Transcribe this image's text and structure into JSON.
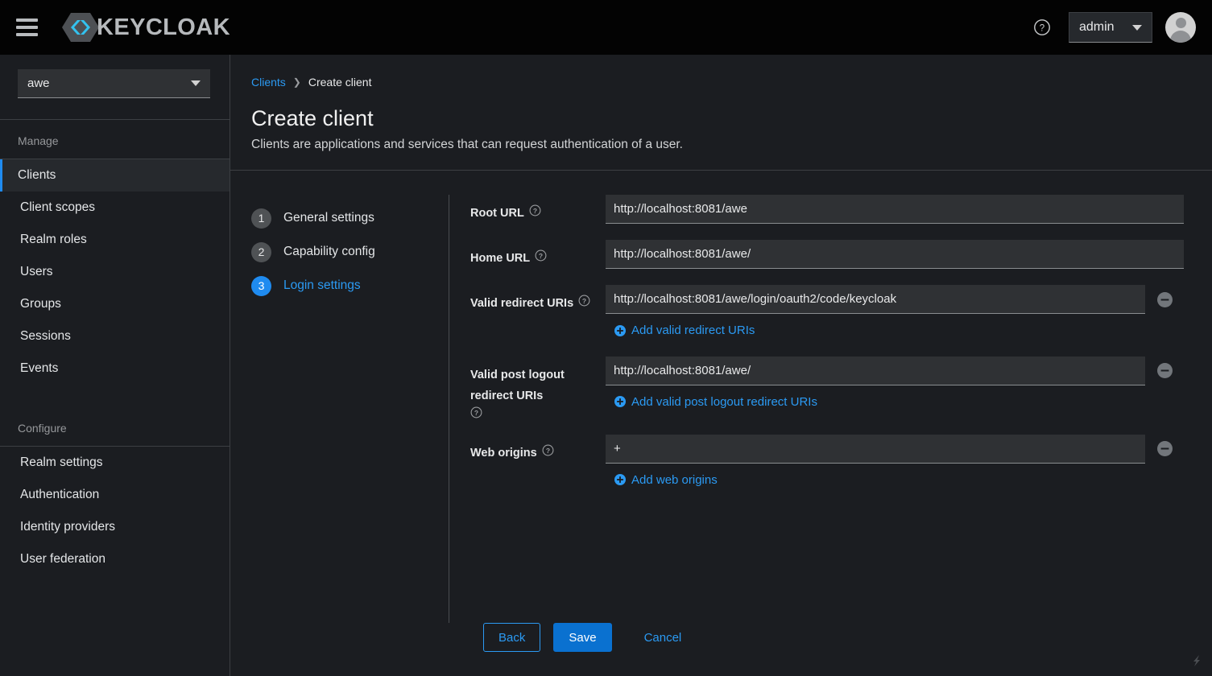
{
  "masthead": {
    "menu_toggle_label": "Global navigation",
    "brand_text": "KEYCLOAK",
    "help_label": "Help",
    "admin_menu_label": "admin",
    "avatar_label": "User avatar"
  },
  "sidebar": {
    "realm_selector": {
      "value": "awe"
    },
    "groups": [
      {
        "title": "Manage",
        "items": [
          {
            "label": "Clients",
            "active": true
          },
          {
            "label": "Client scopes",
            "active": false
          },
          {
            "label": "Realm roles",
            "active": false
          },
          {
            "label": "Users",
            "active": false
          },
          {
            "label": "Groups",
            "active": false
          },
          {
            "label": "Sessions",
            "active": false
          },
          {
            "label": "Events",
            "active": false
          }
        ]
      },
      {
        "title": "Configure",
        "items": [
          {
            "label": "Realm settings",
            "active": false
          },
          {
            "label": "Authentication",
            "active": false
          },
          {
            "label": "Identity providers",
            "active": false
          },
          {
            "label": "User federation",
            "active": false
          }
        ]
      }
    ]
  },
  "breadcrumb": {
    "parent": "Clients",
    "separator": "❯",
    "current": "Create client"
  },
  "page": {
    "title": "Create client",
    "subtitle": "Clients are applications and services that can request authentication of a user."
  },
  "wizard": {
    "steps": [
      {
        "num": "1",
        "label": "General settings",
        "active": false
      },
      {
        "num": "2",
        "label": "Capability config",
        "active": false
      },
      {
        "num": "3",
        "label": "Login settings",
        "active": true
      }
    ]
  },
  "form": {
    "fields": [
      {
        "label": "Root URL",
        "value": "http://localhost:8081/awe",
        "placeholder": "",
        "has_remove": false,
        "add_label": ""
      },
      {
        "label": "Home URL",
        "value": "http://localhost:8081/awe/",
        "placeholder": "",
        "has_remove": false,
        "add_label": ""
      },
      {
        "label": "Valid redirect URIs",
        "value": "http://localhost:8081/awe/login/oauth2/code/keycloak",
        "placeholder": "",
        "has_remove": true,
        "add_label": "Add valid redirect URIs"
      },
      {
        "label": "Valid post logout redirect URIs",
        "value": "http://localhost:8081/awe/",
        "placeholder": "",
        "has_remove": true,
        "add_label": "Add valid post logout redirect URIs"
      },
      {
        "label": "Web origins",
        "value": "+",
        "placeholder": "",
        "has_remove": true,
        "add_label": "Add web origins"
      }
    ]
  },
  "actions": {
    "back": "Back",
    "save": "Save",
    "cancel": "Cancel"
  },
  "colors": {
    "accent_blue": "#2b9af3",
    "primary_blue": "#0a71d0",
    "masthead_bg": "#030303",
    "page_bg": "#1b1d21",
    "input_bg": "#2f3134",
    "brand_cyan": "#33c2ef"
  }
}
